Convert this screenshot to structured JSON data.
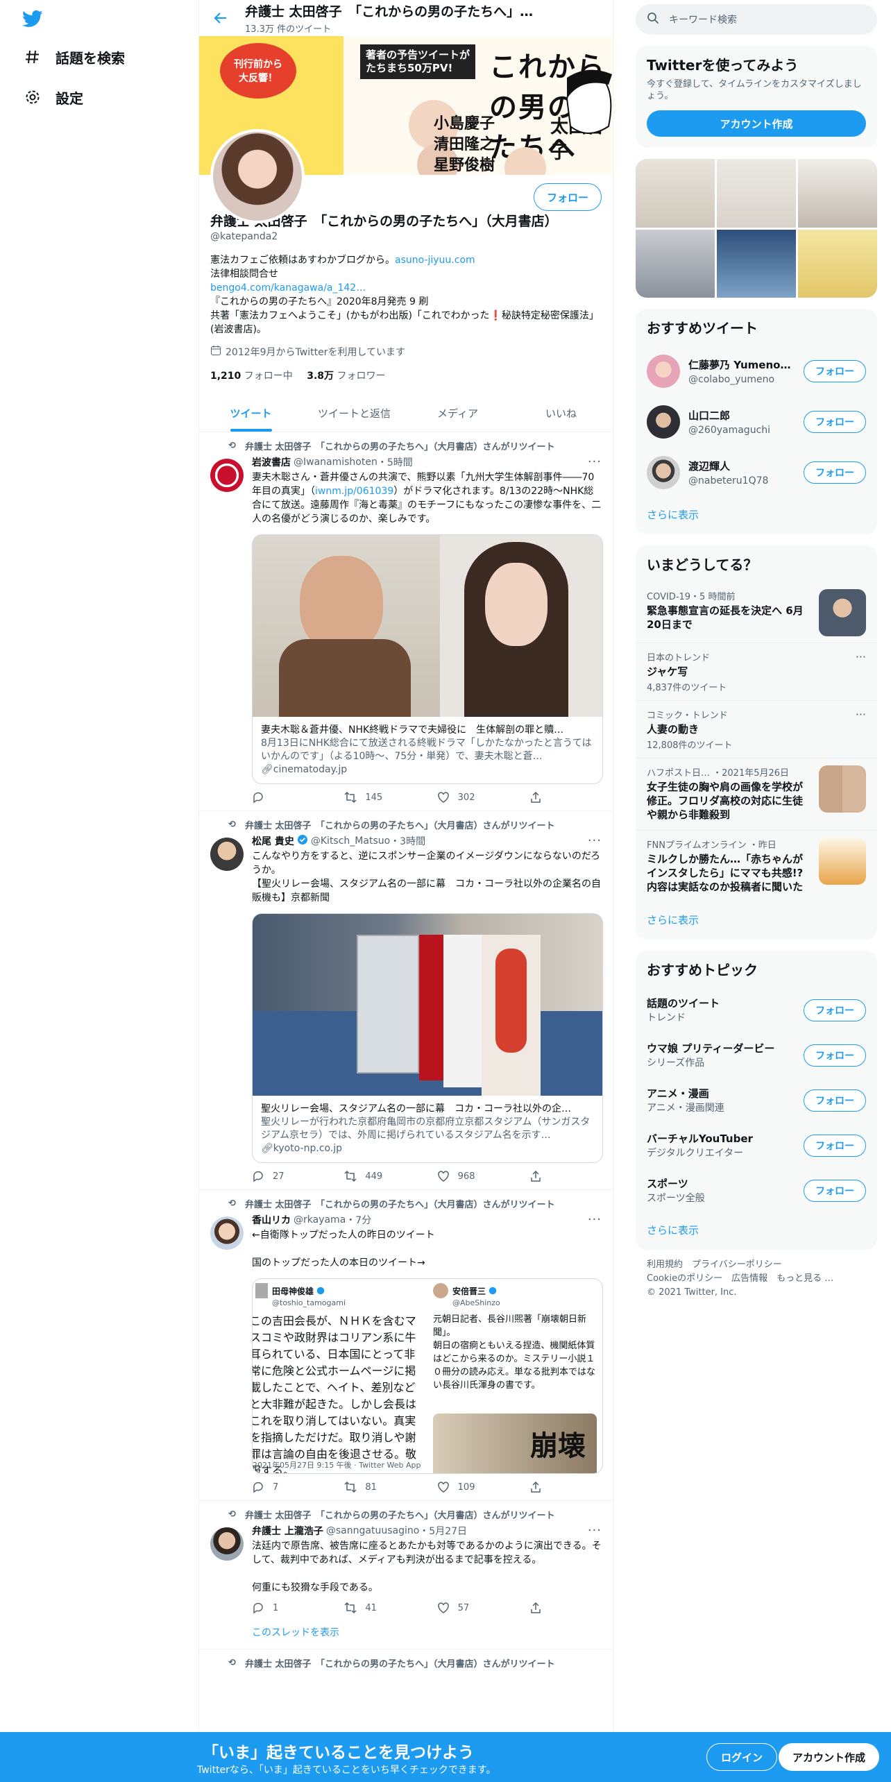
{
  "nav": {
    "explore": "話題を検索",
    "settings": "設定"
  },
  "topbar": {
    "title": "弁護士 太田啓子　「これからの男の子たちへ」…",
    "count": "13.3万 件のツイート"
  },
  "banner": {
    "title": "これからの男の子たちへ",
    "tag1": "刊行前から\n大反響！",
    "tag2": "著者の予告ツイートが\nたちまち50万PV!",
    "names": [
      "小島慶子",
      "清田隆之",
      "星野俊樹",
      "太田啓子"
    ]
  },
  "profile": {
    "follow": "フォロー",
    "name": "弁護士 太田啓子　「これからの男の子たちへ」（大月書店）",
    "handle": "@katepanda2",
    "bio1": "憲法カフェご依頼はあすわかブログから。",
    "bio1_link": "asuno-jiyuu.com",
    "bio2": "法律相談問合せ",
    "bio3_link": "bengo4.com/kanagawa/a_142…",
    "bio4": "『これからの男の子たちへ』2020年8月発売  9 刷",
    "bio5": "共著「憲法カフェへようこそ」(かもがわ出版)「これでわかった❗️秘訣特定秘密保護法」(岩波書店)。",
    "joined": "2012年9月からTwitterを利用しています",
    "following_num": "1,210",
    "following_label": "フォロー中",
    "followers_num": "3.8万",
    "followers_label": "フォロワー"
  },
  "tabs": [
    "ツイート",
    "ツイートと返信",
    "メディア",
    "いいね"
  ],
  "tweets": [
    {
      "rt": "弁護士 太田啓子　「これからの男の子たちへ」（大月書店）さんがリツイート",
      "name": "岩波書店",
      "handle": "@Iwanamishoten",
      "time": "・5時間",
      "text1": "妻夫木聡さん・蒼井優さんの共演で、熊野以素「九州大学生体解剖事件――70年目の真実」（",
      "link": "iwnm.jp/061039",
      "text2": "）がドラマ化されます。8/13の22時～NHK総合にて放送。遠藤周作『海と毒薬』のモチーフにもなったこの凄惨な事件を、二人の名優がどう演じるのか、楽しみです。",
      "card_title": "妻夫木聡＆蒼井優、NHK終戦ドラマで夫婦役に　生体解剖の罪と贖…",
      "card_desc": "8月13日にNHK総合にて放送される終戦ドラマ「しかたなかったと言うてはいかんのです」（よる10時～、75分・単発）で、妻夫木聡と蒼…",
      "card_dom": "cinematoday.jp",
      "reply": "",
      "rts": "145",
      "likes": "302"
    },
    {
      "rt": "弁護士 太田啓子　「これからの男の子たちへ」（大月書店）さんがリツイート",
      "name": "松尾 貴史",
      "handle": "@Kitsch_Matsuo",
      "time": "・3時間",
      "text": "こんなやり方をすると、逆にスポンサー企業のイメージダウンにならないのだろうか。\n【聖火リレー会場、スタジアム名の一部に幕　コカ・コーラ社以外の企業名の自販機も】京都新聞",
      "card_title": "聖火リレー会場、スタジアム名の一部に幕　コカ・コーラ社以外の企…",
      "card_desc": "聖火リレーが行われた京都府亀岡市の京都府立京都スタジアム（サンガスタジアム京セラ）では、外周に掲げられているスタジアム名を示す…",
      "card_dom": "kyoto-np.co.jp",
      "reply": "27",
      "rts": "449",
      "likes": "968"
    },
    {
      "rt": "弁護士 太田啓子　「これからの男の子たちへ」（大月書店）さんがリツイート",
      "name": "香山リカ",
      "handle": "@rkayama",
      "time": "・7分",
      "text": "←自衛隊トップだった人の昨日のツイート\n\n国のトップだった人の本日のツイート→",
      "q1_name": "田母神俊雄",
      "q1_handle": "@toshio_tamogami",
      "q1_text": "この吉田会長が、ＮＨＫを含むマスコミや政財界はコリアン系に牛耳られている、日本国にとって非常に危険と公式ホームページに掲載したことで、ヘイト、差別などと大非難が起きた。しかし会長はこれを取り消してはいない。真実を指摘しただけだ。取り消しや謝罪は言論の自由を後退させる。敬服する。",
      "q1_time": "2021年05月27日 9:15 午後 · Twitter Web App",
      "q2_name": "安倍晋三",
      "q2_handle": "@AbeShinzo",
      "q2_text": "元朝日記者、長谷川煕著「崩壊朝日新聞」。\n朝日の宿痾ともいえる捏造、機関紙体質はどこから来るのか。ミステリー小説１０冊分の読み応え。単なる批判本ではない長谷川氏渾身の書です。",
      "q2_book": "崩壊",
      "reply": "7",
      "rts": "81",
      "likes": "109"
    },
    {
      "rt": "弁護士 太田啓子　「これからの男の子たちへ」（大月書店）さんがリツイート",
      "name": "弁護士 上瀧浩子",
      "handle": "@sanngatuusagino",
      "time": "・5月27日",
      "text": "法廷内で原告席、被告席に座るとあたかも対等であるかのように演出できる。そして、裁判中であれば、メディアも判決が出るまで記事を控える。\n\n何重にも狡猾な手段である。",
      "reply": "1",
      "rts": "41",
      "likes": "57",
      "thread": "このスレッドを表示"
    },
    {
      "rt": "弁護士 太田啓子　「これからの男の子たちへ」（大月書店）さんがリツイート"
    }
  ],
  "sidebar": {
    "search_placeholder": "キーワード検索",
    "signup_title": "Twitterを使ってみよう",
    "signup_sub": "今すぐ登録して、タイムラインをカスタマイズしましょう。",
    "signup_btn": "アカウント作成",
    "rec_title": "おすすめツイート",
    "users": [
      {
        "name": "仁藤夢乃 Yumeno…",
        "handle": "@colabo_yumeno",
        "btn": "フォロー"
      },
      {
        "name": "山口二郎",
        "handle": "@260yamaguchi",
        "btn": "フォロー"
      },
      {
        "name": "渡辺輝人",
        "handle": "@nabeteru1Q78",
        "btn": "フォロー"
      }
    ],
    "showmore": "さらに表示",
    "trends_title": "いまどうしてる？",
    "trends": [
      {
        "ctx": "COVID-19・5 時間前",
        "title": "緊急事態宣言の延長を決定へ 6月20日まで"
      },
      {
        "ctx": "日本のトレンド",
        "title": "ジャケ写",
        "count": "4,837件のツイート"
      },
      {
        "ctx": "コミック・トレンド",
        "title": "人妻の動き",
        "count": "12,808件のツイート"
      },
      {
        "ctx": "ハフポスト日…  ・2021年5月26日",
        "title": "女子生徒の胸や肩の画像を学校が修正。フロリダ高校の対応に生徒や親から非難殺到"
      },
      {
        "ctx": "FNNプライムオンライン  ・昨日",
        "title": "ミルクしか勝たん…「赤ちゃんがインスタしたら」にママも共感!? 内容は実話なのか投稿者に聞いた"
      }
    ],
    "topics_title": "おすすめトピック",
    "topics": [
      {
        "name": "話題のツイート",
        "sub": "トレンド",
        "btn": "フォロー"
      },
      {
        "name": "ウマ娘 プリティーダービー",
        "sub": "シリーズ作品",
        "btn": "フォロー"
      },
      {
        "name": "アニメ・漫画",
        "sub": "アニメ・漫画関連",
        "btn": "フォロー"
      },
      {
        "name": "バーチャルYouTuber",
        "sub": "デジタルクリエイター",
        "btn": "フォロー"
      },
      {
        "name": "スポーツ",
        "sub": "スポーツ全般",
        "btn": "フォロー"
      }
    ],
    "footer1": "利用規約　プライバシーポリシー",
    "footer2": "Cookieのポリシー　広告情報　もっと見る …",
    "footer3": "© 2021 Twitter, Inc."
  },
  "bottom": {
    "title": "「いま」起きていることを見つけよう",
    "sub": "Twitterなら、「いま」起きていることをいち早くチェックできます。",
    "login": "ログイン",
    "signup": "アカウント作成"
  },
  "colors": {
    "accent": "#1d9bf0",
    "text": "#0f1419",
    "muted": "#536471"
  }
}
